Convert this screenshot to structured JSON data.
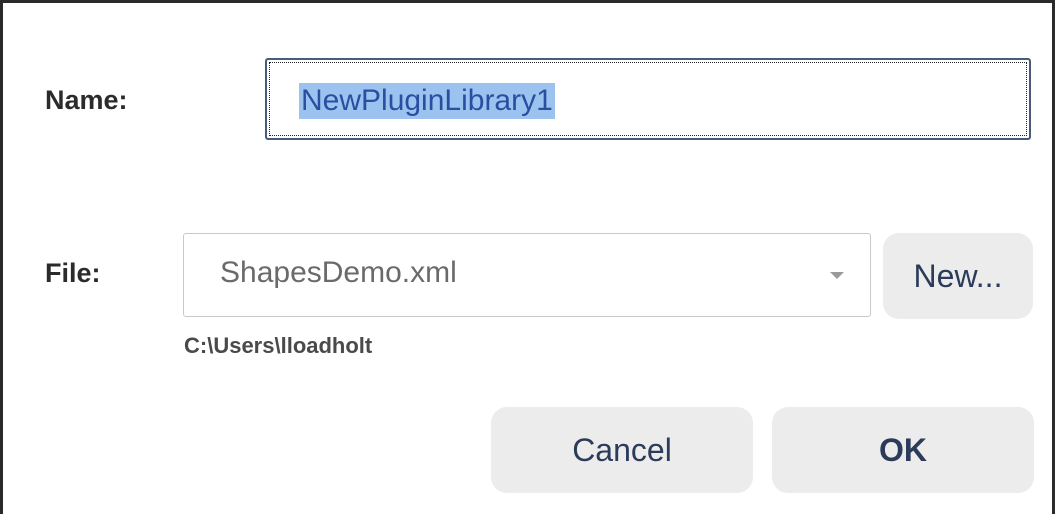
{
  "form": {
    "name_label": "Name:",
    "name_value": "NewPluginLibrary1",
    "file_label": "File:",
    "file_selected": "ShapesDemo.xml",
    "file_path": "C:\\Users\\lloadholt"
  },
  "buttons": {
    "new_label": "New...",
    "cancel_label": "Cancel",
    "ok_label": "OK"
  },
  "icons": {
    "file_dropdown": "chevron-down-icon"
  },
  "colors": {
    "selection_highlight": "#9cc3ef",
    "button_bg": "#ececec",
    "button_text": "#2c3b5a",
    "focus_border": "#4a5a7a"
  }
}
